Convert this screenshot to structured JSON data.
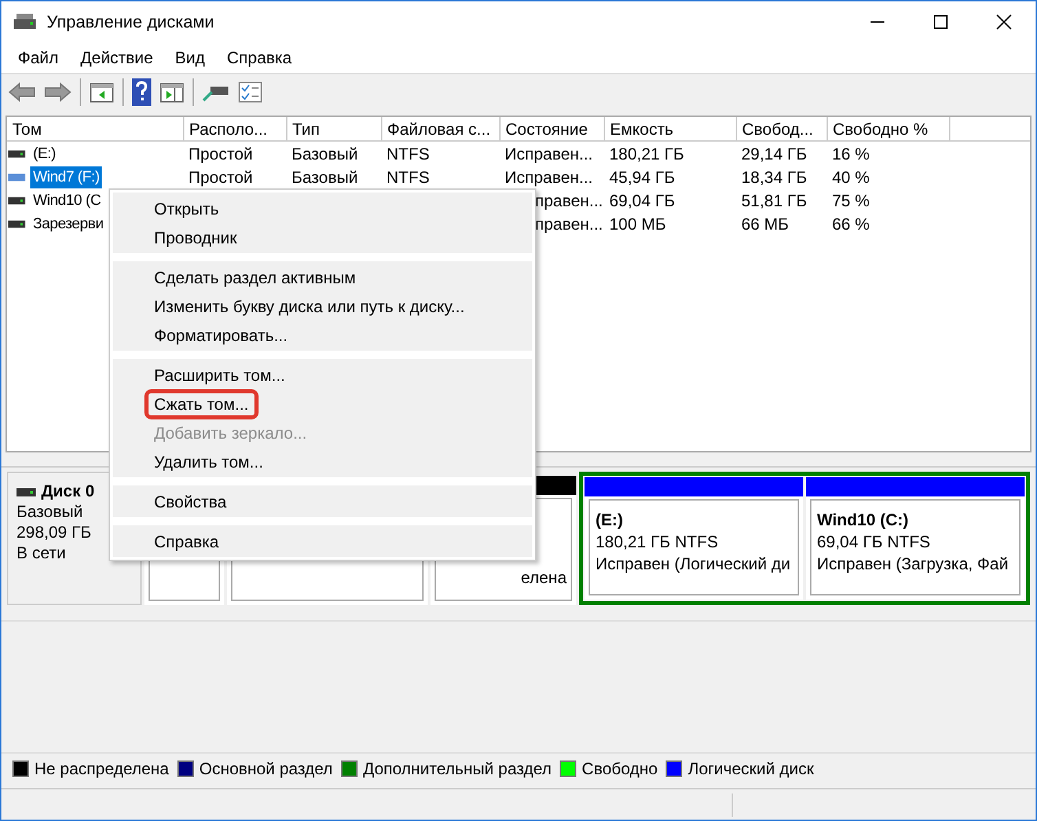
{
  "window": {
    "title": "Управление дисками"
  },
  "menu_bar": [
    "Файл",
    "Действие",
    "Вид",
    "Справка"
  ],
  "volumes": {
    "columns": [
      "Том",
      "Располо...",
      "Тип",
      "Файловая с...",
      "Состояние",
      "Емкость",
      "Свобод...",
      "Свободно %"
    ],
    "rows": [
      {
        "selected": false,
        "cells": [
          " (E:)",
          "Простой",
          "Базовый",
          "NTFS",
          "Исправен...",
          "180,21 ГБ",
          "29,14 ГБ",
          "16 %"
        ]
      },
      {
        "selected": true,
        "cells": [
          "Wind7 (F:)",
          "Простой",
          "Базовый",
          "NTFS",
          "Исправен...",
          "45,94 ГБ",
          "18,34 ГБ",
          "40 %"
        ]
      },
      {
        "selected": false,
        "cells": [
          "Wind10 (C",
          null,
          null,
          null,
          "правен...",
          "69,04 ГБ",
          "51,81 ГБ",
          "75 %"
        ]
      },
      {
        "selected": false,
        "cells": [
          "Зарезерви",
          null,
          null,
          null,
          "правен...",
          "100 МБ",
          "66 МБ",
          "66 %"
        ]
      }
    ]
  },
  "disk": {
    "name": "Диск 0",
    "type": "Базовый",
    "size": "298,09 ГБ",
    "status": "В сети",
    "partitions": [
      {
        "kind": "partition"
      },
      {
        "kind": "partition"
      },
      {
        "kind": "unallocated",
        "label": "елена"
      },
      {
        "kind": "extended",
        "children": [
          {
            "kind": "logical",
            "name": " (E:)",
            "size": "180,21 ГБ NTFS",
            "status": "Исправен (Логический ди"
          },
          {
            "kind": "logical",
            "name": "Wind10  (C:)",
            "size": "69,04 ГБ NTFS",
            "status": "Исправен (Загрузка, Фай"
          }
        ]
      }
    ]
  },
  "legend": [
    {
      "label": "Не распределена",
      "color": "#000000"
    },
    {
      "label": "Основной раздел",
      "color": "#000080"
    },
    {
      "label": "Дополнительный раздел",
      "color": "#008000"
    },
    {
      "label": "Свободно",
      "color": "#00ff00"
    },
    {
      "label": "Логический диск",
      "color": "#0000ff"
    }
  ],
  "context_menu": [
    [
      {
        "label": "Открыть",
        "disabled": false,
        "highlighted": false
      },
      {
        "label": "Проводник",
        "disabled": false,
        "highlighted": false
      }
    ],
    [
      {
        "label": "Сделать раздел активным",
        "disabled": false,
        "highlighted": false
      },
      {
        "label": "Изменить букву диска или путь к диску...",
        "disabled": false,
        "highlighted": false
      },
      {
        "label": "Форматировать...",
        "disabled": false,
        "highlighted": false
      }
    ],
    [
      {
        "label": "Расширить том...",
        "disabled": false,
        "highlighted": false
      },
      {
        "label": "Сжать том...",
        "disabled": false,
        "highlighted": true
      },
      {
        "label": "Добавить зеркало...",
        "disabled": true,
        "highlighted": false
      },
      {
        "label": "Удалить том...",
        "disabled": false,
        "highlighted": false
      }
    ],
    [
      {
        "label": "Свойства",
        "disabled": false,
        "highlighted": false
      }
    ],
    [
      {
        "label": "Справка",
        "disabled": false,
        "highlighted": false
      }
    ]
  ]
}
